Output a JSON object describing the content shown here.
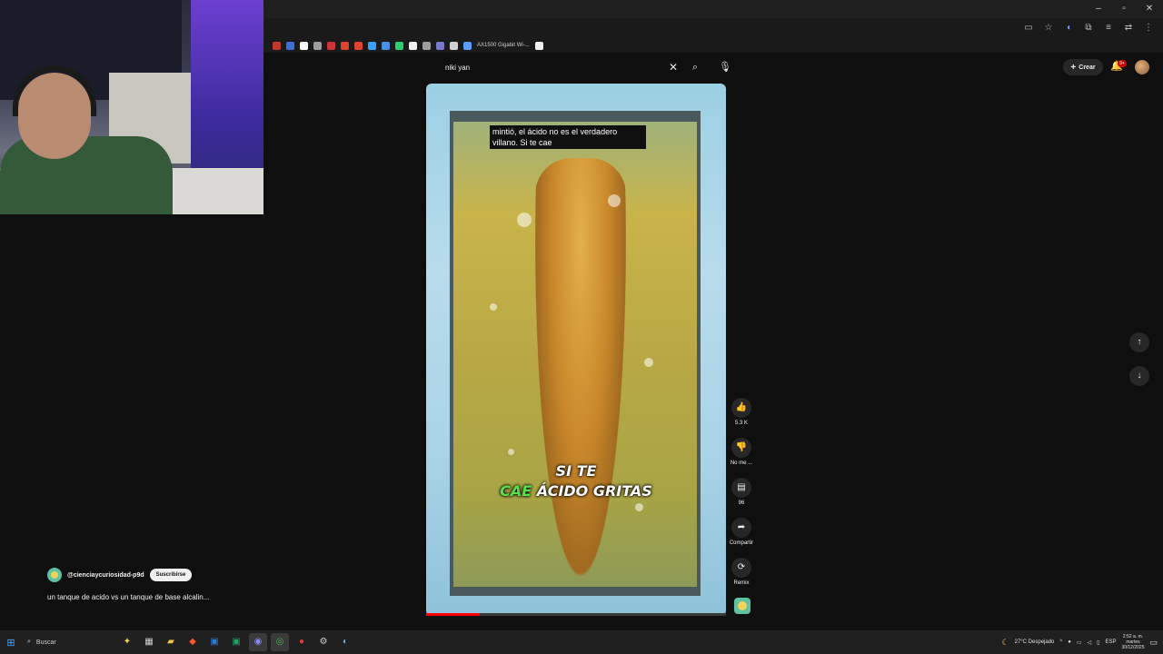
{
  "window_controls": {
    "minimize": "–",
    "maximize": "▫",
    "close": "✕"
  },
  "bookmarks": {
    "item_label": "AX1500 Gigabit Wi-...",
    "colors": [
      "#c0392b",
      "#3a6fd8",
      "#ffffff",
      "#9e9e9e",
      "#cc3333",
      "#e0442e",
      "#3aa0ff",
      "#4a90e2",
      "#2ecc71",
      "#f1f1f1",
      "#9e9e9e",
      "#7a7acc",
      "#d0d0d0",
      "#5aa0ff"
    ]
  },
  "header": {
    "search_value": "niki yan",
    "create_label": "Crear",
    "notifications_badge": "9+"
  },
  "video": {
    "caption_text": "mintió, el ácido no es el verdadero villano. Si te cae",
    "overlay_line1": "SI TE",
    "overlay_word_green": "CAE",
    "overlay_line2_rest": " ÁCIDO GRITAS",
    "progress_fraction": 0.18
  },
  "actions": {
    "like_count": "5.3 K",
    "dislike_label": "No me ...",
    "comments_count": "96",
    "share_label": "Compartir",
    "remix_label": "Remix"
  },
  "channel": {
    "handle": "@cienciaycuriosidad-p9d",
    "subscribe_label": "Suscribirse",
    "description": "un tanque de acido vs un tanque de base alcalin..."
  },
  "taskbar": {
    "search_label": "Buscar",
    "weather": "27°C Despejado",
    "language": "ESP",
    "time": "2:52 a. m.",
    "day": "martes",
    "date": "30/12/2025"
  },
  "colors": {
    "accent_red": "#ff0000",
    "caption_green": "#56e04a",
    "background": "#0f0f0f"
  }
}
